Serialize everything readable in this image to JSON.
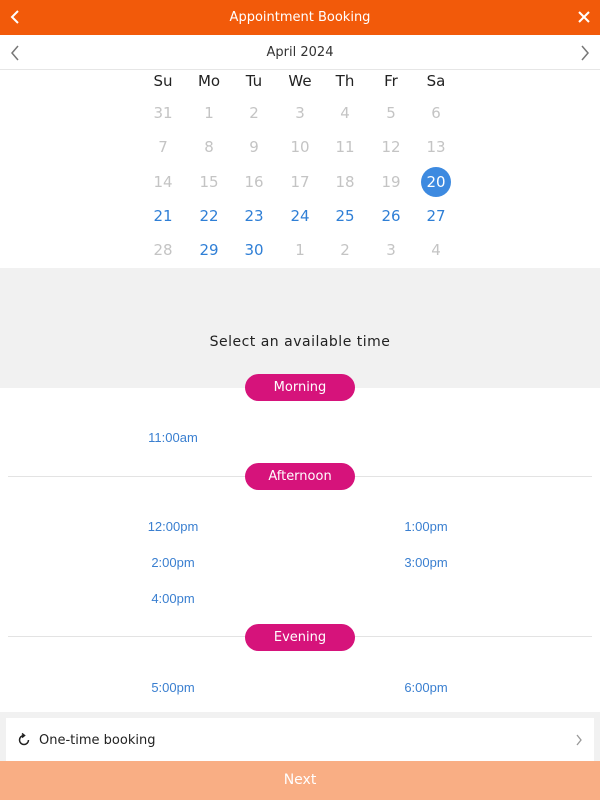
{
  "header": {
    "title": "Appointment Booking",
    "back_icon": "chevron-left-icon",
    "close_icon": "close-icon"
  },
  "calendar": {
    "month_label": "April 2024",
    "weekdays": [
      "Su",
      "Mo",
      "Tu",
      "We",
      "Th",
      "Fr",
      "Sa"
    ],
    "weeks": [
      [
        {
          "d": "31",
          "s": "muted"
        },
        {
          "d": "1",
          "s": "muted"
        },
        {
          "d": "2",
          "s": "muted"
        },
        {
          "d": "3",
          "s": "muted"
        },
        {
          "d": "4",
          "s": "muted"
        },
        {
          "d": "5",
          "s": "muted"
        },
        {
          "d": "6",
          "s": "muted"
        }
      ],
      [
        {
          "d": "7",
          "s": "muted"
        },
        {
          "d": "8",
          "s": "muted"
        },
        {
          "d": "9",
          "s": "muted"
        },
        {
          "d": "10",
          "s": "muted"
        },
        {
          "d": "11",
          "s": "muted"
        },
        {
          "d": "12",
          "s": "muted"
        },
        {
          "d": "13",
          "s": "muted"
        }
      ],
      [
        {
          "d": "14",
          "s": "muted"
        },
        {
          "d": "15",
          "s": "muted"
        },
        {
          "d": "16",
          "s": "muted"
        },
        {
          "d": "17",
          "s": "muted"
        },
        {
          "d": "18",
          "s": "muted"
        },
        {
          "d": "19",
          "s": "muted"
        },
        {
          "d": "20",
          "s": "selected"
        }
      ],
      [
        {
          "d": "21",
          "s": "avail"
        },
        {
          "d": "22",
          "s": "avail"
        },
        {
          "d": "23",
          "s": "avail"
        },
        {
          "d": "24",
          "s": "avail"
        },
        {
          "d": "25",
          "s": "avail"
        },
        {
          "d": "26",
          "s": "avail"
        },
        {
          "d": "27",
          "s": "avail"
        }
      ],
      [
        {
          "d": "28",
          "s": "muted"
        },
        {
          "d": "29",
          "s": "avail"
        },
        {
          "d": "30",
          "s": "avail"
        },
        {
          "d": "1",
          "s": "muted"
        },
        {
          "d": "2",
          "s": "muted"
        },
        {
          "d": "3",
          "s": "muted"
        },
        {
          "d": "4",
          "s": "muted"
        }
      ]
    ]
  },
  "time_prompt": "Select an available time",
  "sections": {
    "morning": {
      "label": "Morning",
      "slots": [
        "11:00am"
      ]
    },
    "afternoon": {
      "label": "Afternoon",
      "slots": [
        "12:00pm",
        "1:00pm",
        "2:00pm",
        "3:00pm",
        "4:00pm"
      ]
    },
    "evening": {
      "label": "Evening",
      "slots": [
        "5:00pm",
        "6:00pm"
      ]
    }
  },
  "booking": {
    "label": "One-time booking",
    "icon": "refresh-icon",
    "chevron": "chevron-right-icon"
  },
  "footer": {
    "next_label": "Next"
  },
  "colors": {
    "header": "#f25a0a",
    "pill": "#d6137b",
    "selected_day": "#3d8ae0",
    "link": "#3a7fd0",
    "next_button": "#f9ae84"
  }
}
